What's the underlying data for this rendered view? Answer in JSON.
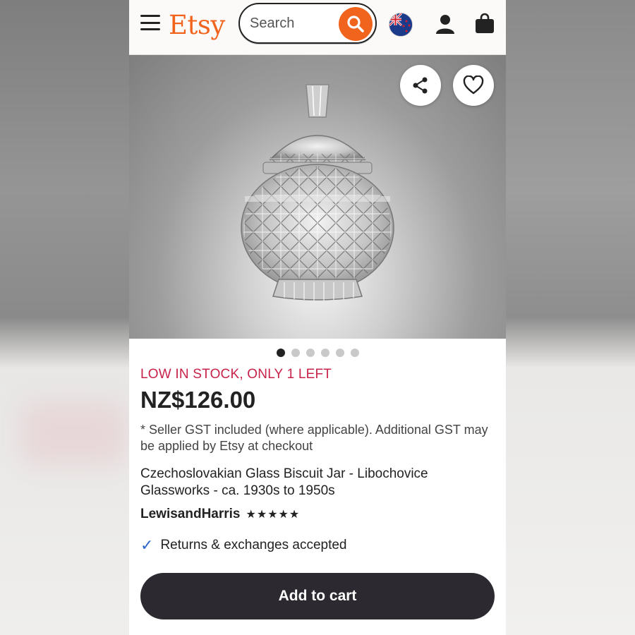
{
  "header": {
    "logo": "Etsy",
    "search_placeholder": "Search",
    "menu_icon": "hamburger-menu-icon",
    "search_icon": "search-icon",
    "flag_icon": "new-zealand-flag-icon",
    "account_icon": "user-icon",
    "cart_icon": "shopping-bag-icon"
  },
  "gallery": {
    "image_count": 6,
    "active_index": 0,
    "share_icon": "share-icon",
    "favorite_icon": "heart-icon"
  },
  "listing": {
    "stock_notice": "LOW IN STOCK, ONLY 1 LEFT",
    "price": "NZ$126.00",
    "gst_note": "* Seller GST included (where applicable). Additional GST may be applied by Etsy at checkout",
    "title": "Czechoslovakian Glass Biscuit Jar - Libochovice Glassworks - ca. 1930s to 1950s",
    "seller": "LewisandHarris",
    "rating_stars": "★★★★★",
    "rating": 5,
    "returns_text": "Returns & exchanges accepted",
    "add_to_cart": "Add to cart"
  },
  "colors": {
    "brand_orange": "#f1641e",
    "stock_red": "#c7234a",
    "cart_button": "#2c2a30",
    "check_blue": "#2f66c9"
  }
}
